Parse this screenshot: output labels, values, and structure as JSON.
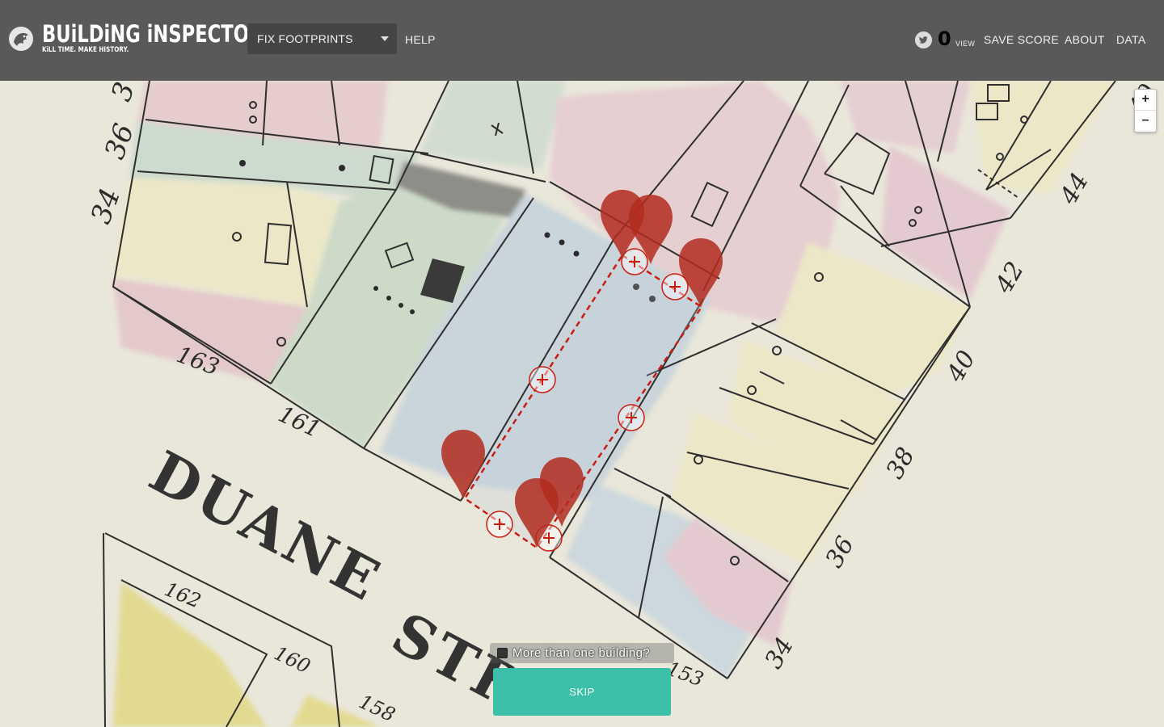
{
  "header": {
    "logo_title": "BUiLDiNG iNSPECTOR",
    "logo_tagline": "KiLL TIME. MAKE HISTORY.",
    "mode_selected": "FIX FOOTPRINTS",
    "help_label": "HELP",
    "score_value": "0",
    "score_label": "VIEW",
    "save_score_label": "SAVE SCORE",
    "about_label": "ABOUT",
    "data_label": "DATA"
  },
  "zoom": {
    "in_label": "+",
    "out_label": "–"
  },
  "map": {
    "street_name": "DUANE STREET",
    "lot_numbers": [
      "34",
      "36",
      "163",
      "161",
      "162",
      "160",
      "158",
      "44",
      "42",
      "40",
      "38",
      "36",
      "34",
      "153"
    ]
  },
  "controls": {
    "multi_building_label": "More than one building?",
    "multi_building_checked": false,
    "skip_label": "SKIP"
  },
  "colors": {
    "header_bg": "#595959",
    "skip_bg": "#3bbfa9",
    "marker": "#b12b1e"
  }
}
